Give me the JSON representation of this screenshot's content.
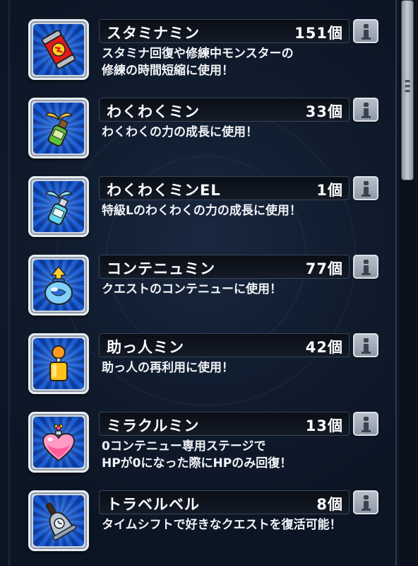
{
  "items": [
    {
      "name": "スタミナミン",
      "count": "151個",
      "desc": "スタミナ回復や修練中モンスターの\n修練の時間短縮に使用！",
      "icon": "stamina-can-icon"
    },
    {
      "name": "わくわくミン",
      "count": "33個",
      "desc": "わくわくの力の成長に使用！",
      "icon": "sprout-bottle-icon"
    },
    {
      "name": "わくわくミンEL",
      "count": "1個",
      "desc": "特級Lのわくわくの力の成長に使用！",
      "icon": "el-bottle-icon"
    },
    {
      "name": "コンテニュミン",
      "count": "77個",
      "desc": "クエストのコンテニューに使用！",
      "icon": "continue-orb-icon"
    },
    {
      "name": "助っ人ミン",
      "count": "42個",
      "desc": "助っ人の再利用に使用！",
      "icon": "helper-figure-icon"
    },
    {
      "name": "ミラクルミン",
      "count": "13個",
      "desc": "0コンテニュー専用ステージで\nHPが0になった際にHPのみ回復！",
      "icon": "heart-bottle-icon"
    },
    {
      "name": "トラベルベル",
      "count": "8個",
      "desc": "タイムシフトで好きなクエストを復活可能！",
      "icon": "bell-icon"
    }
  ],
  "colors": {
    "frame": "#e9edf2",
    "icon_bg": "#1a5bd0",
    "text": "#ffffff"
  }
}
